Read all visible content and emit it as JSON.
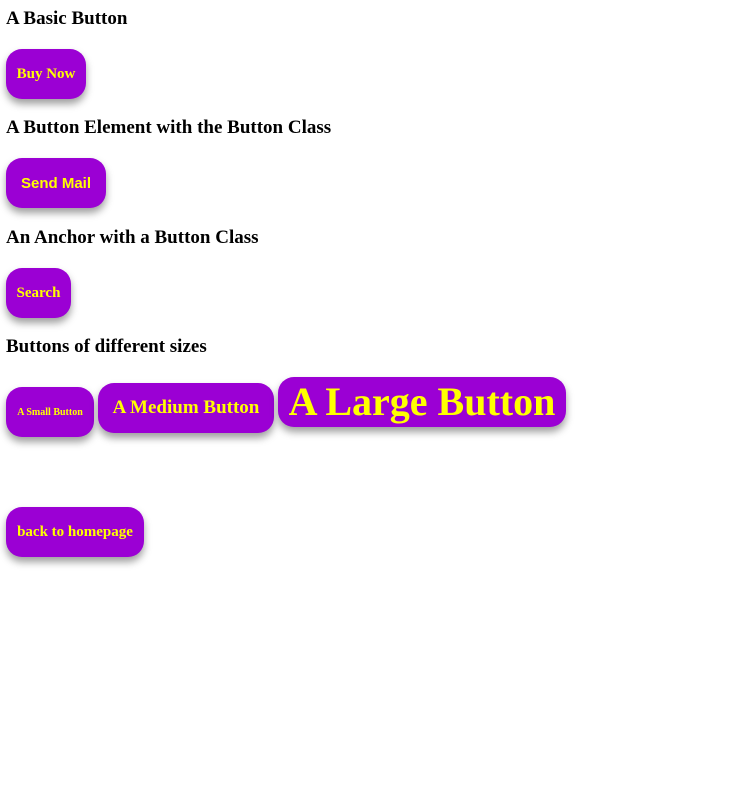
{
  "sections": {
    "basic": {
      "heading": "A Basic Button",
      "button_label": "Buy Now"
    },
    "element": {
      "heading": "A Button Element with the Button Class",
      "button_label": "Send Mail"
    },
    "anchor": {
      "heading": "An Anchor with a Button Class",
      "button_label": "Search"
    },
    "sizes": {
      "heading": "Buttons of different sizes",
      "small_label": "A Small Button",
      "medium_label": "A Medium Button",
      "large_label": "A Large Button"
    }
  },
  "footer": {
    "back_label": "back to homepage"
  },
  "colors": {
    "button_background": "#9b00d4",
    "button_text": "#ffff00",
    "page_background": "#ffffff"
  }
}
